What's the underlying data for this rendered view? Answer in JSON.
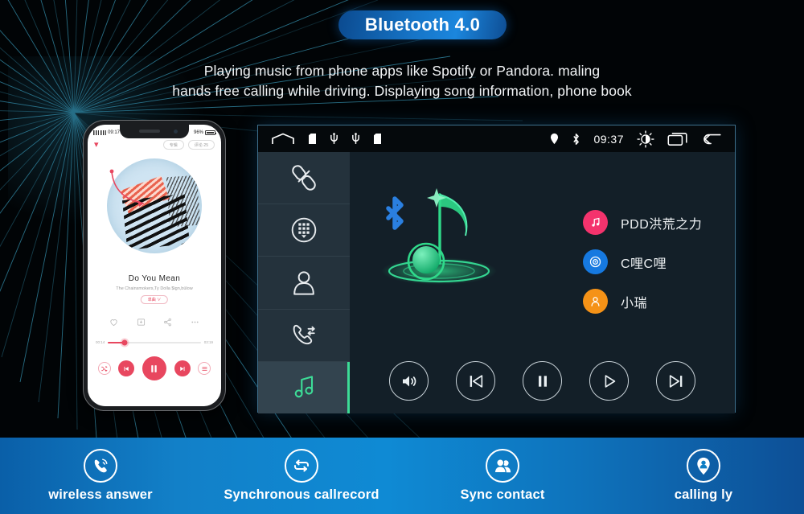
{
  "title_badge": {
    "label": "Bluetooth 4.0",
    "color": "#1674c6"
  },
  "subtitle": {
    "line1": "Playing music from phone apps like Spotify or Pandora. maling",
    "line2": "hands free calling while driving. Displaying  song information, phone book"
  },
  "phone": {
    "status": {
      "time": "09:17",
      "battery": "96%"
    },
    "topbar": {
      "pill1": "专辑",
      "pill2": "评论·25"
    },
    "now_playing": {
      "title": "Do You Mean",
      "artist": "The Chainsmokers,Ty Dolla $ign,bülow",
      "tag": "单曲 ∨"
    },
    "actions": [
      "heart-icon",
      "download-icon",
      "share-icon",
      "more-icon"
    ],
    "progress": {
      "elapsed": "00:14",
      "total": "03:19",
      "percent": 18
    },
    "controls": [
      "shuffle-icon",
      "previous-icon",
      "pause-icon",
      "next-icon",
      "playlist-icon"
    ]
  },
  "head_unit": {
    "status_bar": {
      "left_icons": [
        "home-icon",
        "sdcard-icon",
        "usb-icon",
        "usb-icon",
        "sdcard-icon"
      ],
      "right_icons": [
        "location-pin-icon",
        "bluetooth-icon"
      ],
      "time": "09:37",
      "trailing_icons": [
        "brightness-icon",
        "recent-apps-icon",
        "back-arrow-icon"
      ]
    },
    "sidebar": [
      {
        "name": "bluetooth-link-icon",
        "label": "Connect",
        "active": false
      },
      {
        "name": "dialpad-icon",
        "label": "Dialpad",
        "active": false
      },
      {
        "name": "contacts-icon",
        "label": "Contacts",
        "active": false
      },
      {
        "name": "call-records-icon",
        "label": "Call records",
        "active": false
      },
      {
        "name": "music-icon",
        "label": "Music",
        "active": true
      }
    ],
    "hero": {
      "icon": "bluetooth-music-note",
      "accent": "#2fd98a",
      "bluetooth_color": "#2a7fe0"
    },
    "songs": [
      {
        "badge": "music-note-icon",
        "color": "#f4336d",
        "name": "PDD洪荒之力"
      },
      {
        "badge": "disc-icon",
        "color": "#1679e0",
        "name": "C哩C哩"
      },
      {
        "badge": "person-icon",
        "color": "#f59217",
        "name": "小瑞"
      }
    ],
    "controls": [
      {
        "name": "volume-button",
        "icon": "volume-icon"
      },
      {
        "name": "previous-button",
        "icon": "previous-icon"
      },
      {
        "name": "pause-button",
        "icon": "pause-icon"
      },
      {
        "name": "play-button",
        "icon": "play-icon"
      },
      {
        "name": "next-button",
        "icon": "next-icon"
      }
    ]
  },
  "features": [
    {
      "icon": "phone-waves-icon",
      "label": "wireless answer"
    },
    {
      "icon": "sync-loop-icon",
      "label": "Synchronous callrecord"
    },
    {
      "icon": "two-people-icon",
      "label": "Sync contact"
    },
    {
      "icon": "person-pin-icon",
      "label": "calling ly"
    }
  ]
}
